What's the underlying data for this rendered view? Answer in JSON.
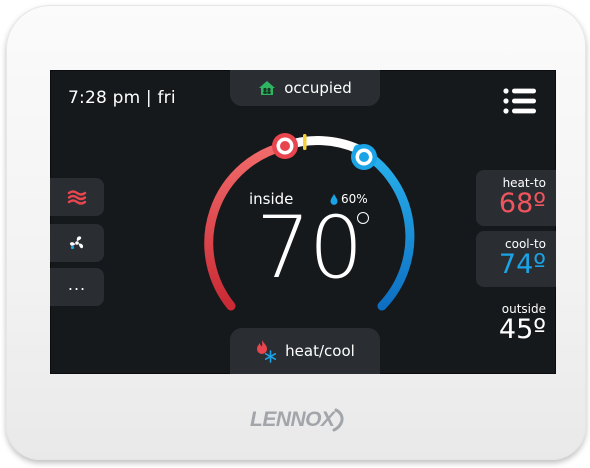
{
  "status_bar": {
    "time_day": "7:28 pm | fri",
    "occupancy": "occupied",
    "occupancy_icon": "home-icon",
    "menu_icon": "menu-icon"
  },
  "side_buttons": [
    {
      "name": "heat-mode-button",
      "icon": "heat-waves-icon"
    },
    {
      "name": "fan-button",
      "icon": "fan-icon"
    },
    {
      "name": "more-button",
      "icon": "more-icon",
      "label": "..."
    }
  ],
  "dial": {
    "inside_label": "inside",
    "humidity": "60%",
    "inside_temp": "70",
    "heat_color": "#e8454e",
    "cool_color": "#1aa3e6"
  },
  "setpoints": {
    "heat_to_label": "heat-to",
    "heat_to_value": "68º",
    "cool_to_label": "cool-to",
    "cool_to_value": "74º",
    "outside_label": "outside",
    "outside_value": "45º"
  },
  "mode": {
    "label": "heat/cool",
    "icon": "heat-cool-icon"
  },
  "brand": {
    "logo_text": "LENNOX"
  }
}
